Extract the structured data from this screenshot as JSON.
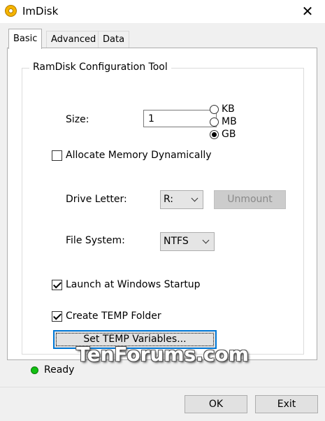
{
  "window": {
    "title": "ImDisk"
  },
  "tabs": [
    {
      "label": "Basic",
      "active": true
    },
    {
      "label": "Advanced",
      "active": false
    },
    {
      "label": "Data",
      "active": false
    }
  ],
  "group": {
    "title": "RamDisk Configuration Tool",
    "size_label": "Size:",
    "size_value": "1",
    "units": [
      {
        "label": "KB",
        "checked": false
      },
      {
        "label": "MB",
        "checked": false
      },
      {
        "label": "GB",
        "checked": true
      }
    ],
    "allocate_dynamic": {
      "label": "Allocate Memory Dynamically",
      "checked": false
    },
    "drive_letter_label": "Drive Letter:",
    "drive_letter_value": "R:",
    "unmount_label": "Unmount",
    "file_system_label": "File System:",
    "file_system_value": "NTFS",
    "launch_startup": {
      "label": "Launch at Windows Startup",
      "checked": true
    },
    "create_temp": {
      "label": "Create TEMP Folder",
      "checked": true
    },
    "set_temp_label": "Set TEMP Variables..."
  },
  "watermark": "TenForums.com",
  "status": {
    "text": "Ready",
    "color": "#12c012"
  },
  "footer": {
    "ok_label": "OK",
    "exit_label": "Exit"
  },
  "icons": {
    "app": "imdisk-app-icon",
    "close": "close-icon",
    "status": "status-dot-icon"
  }
}
